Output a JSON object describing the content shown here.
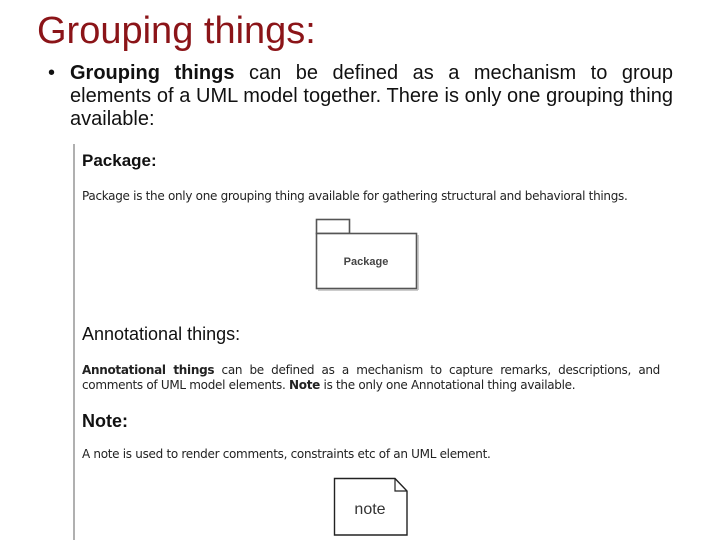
{
  "slide": {
    "title": "Grouping things:",
    "bullet": {
      "bold_lead": "Grouping things",
      "text": " can be defined as a mechanism to group elements of a UML model together. There is only one grouping thing available:"
    }
  },
  "embedded": {
    "package_section": {
      "heading": "Package:",
      "description": "Package is the only one grouping thing available for gathering structural and behavioral things.",
      "diagram_label": "Package"
    },
    "annotational_section": {
      "heading": "Annotational things:",
      "bold_lead": "Annotational things",
      "text_part1": " can be defined as a mechanism to capture remarks, descriptions, and comments of UML model elements. ",
      "bold_note": "Note",
      "text_part2": " is the only one Annotational thing available."
    },
    "note_section": {
      "heading": "Note:",
      "description": "A note is used to render comments, constraints etc of an UML element.",
      "diagram_label": "note"
    }
  },
  "colors": {
    "title": "#8b1418",
    "body_text": "#111111"
  }
}
